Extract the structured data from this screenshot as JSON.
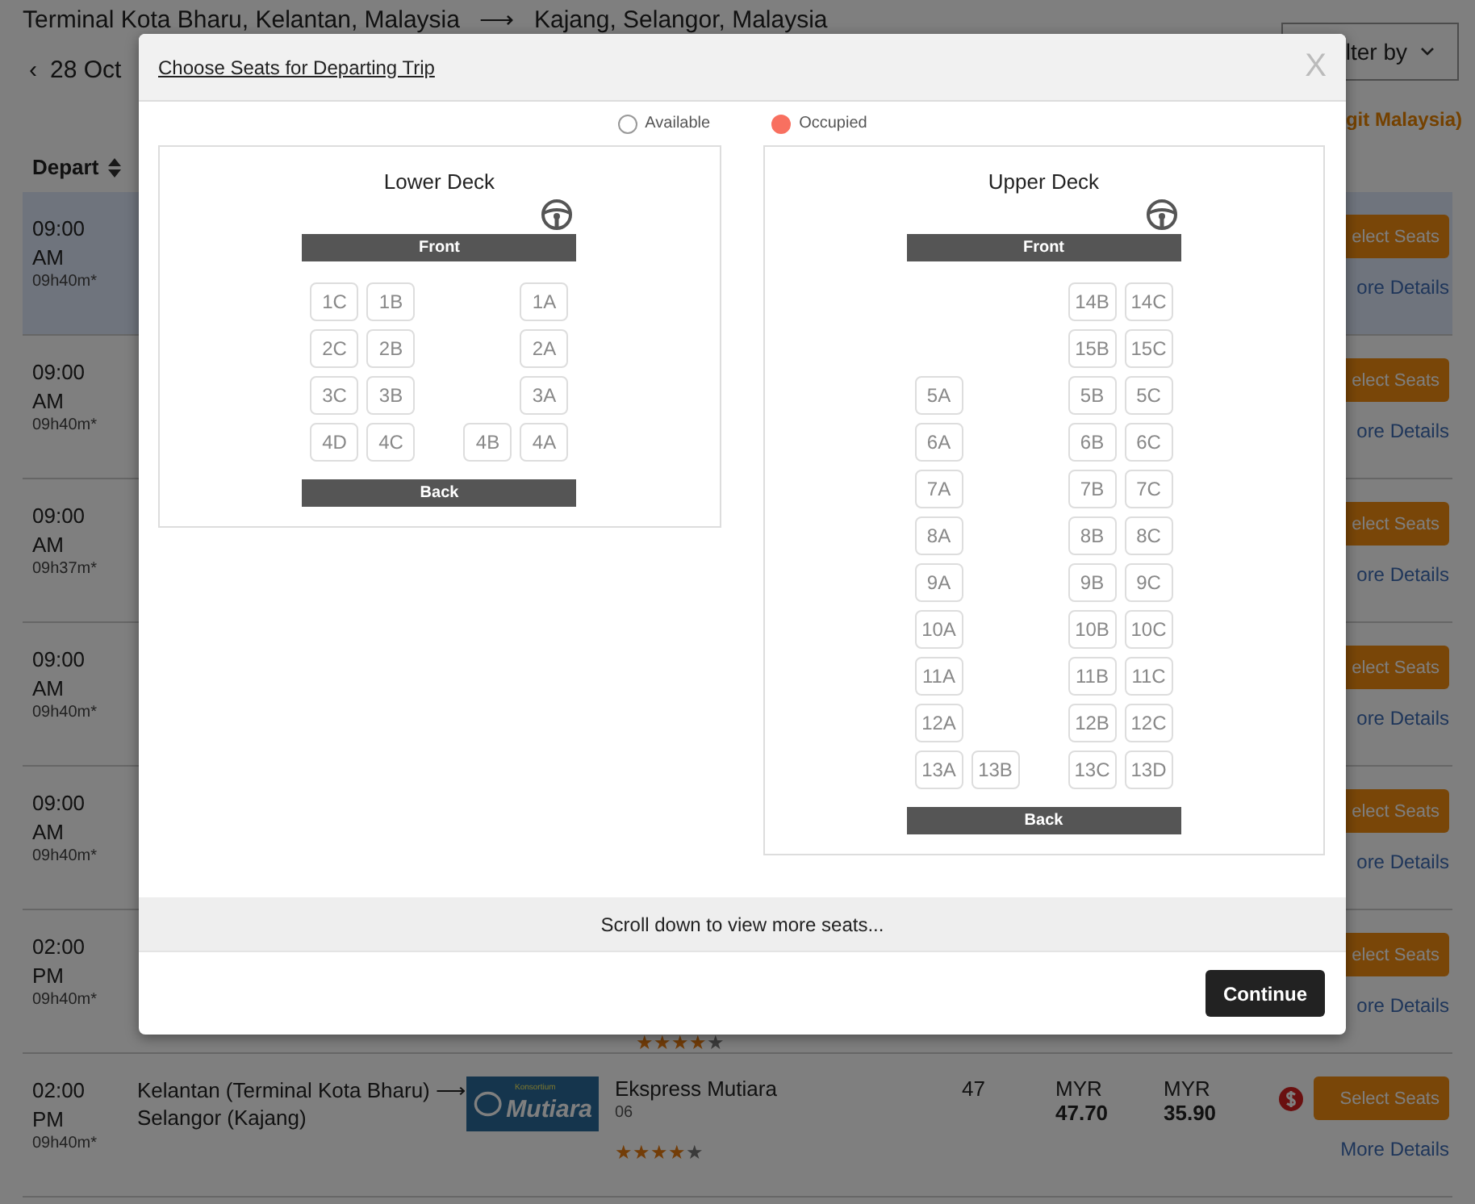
{
  "route": {
    "origin": "Terminal Kota Bharu, Kelantan, Malaysia",
    "arrow": "⟶",
    "destination": "Kajang, Selangor, Malaysia"
  },
  "date": {
    "back": "‹",
    "label": "28 Oct"
  },
  "filter_button": {
    "label": "lter by"
  },
  "currency_note": "git Malaysia)",
  "column_header": {
    "label": "Depart"
  },
  "trips": [
    {
      "time": "09:00",
      "period": "AM",
      "duration": "09h40m*",
      "selected": true,
      "select_label": "elect Seats",
      "details_label": "ore Details"
    },
    {
      "time": "09:00",
      "period": "AM",
      "duration": "09h40m*",
      "selected": false,
      "select_label": "elect Seats",
      "details_label": "ore Details"
    },
    {
      "time": "09:00",
      "period": "AM",
      "duration": "09h37m*",
      "selected": false,
      "select_label": "elect Seats",
      "details_label": "ore Details"
    },
    {
      "time": "09:00",
      "period": "AM",
      "duration": "09h40m*",
      "selected": false,
      "select_label": "elect Seats",
      "details_label": "ore Details"
    },
    {
      "time": "09:00",
      "period": "AM",
      "duration": "09h40m*",
      "selected": false,
      "select_label": "elect Seats",
      "details_label": "ore Details"
    },
    {
      "time": "02:00",
      "period": "PM",
      "duration": "09h40m*",
      "selected": false,
      "select_label": "elect Seats",
      "details_label": "ore Details",
      "stars": 4
    },
    {
      "time": "02:00",
      "period": "PM",
      "duration": "09h40m*",
      "selected": false,
      "route": "Kelantan (Terminal Kota Bharu) ⟶ Selangor (Kajang)",
      "logo_small": "Konsortium",
      "logo_text": "Mutiara",
      "operator": "Ekspress Mutiara",
      "code": "06",
      "stars": 4,
      "seats": "47",
      "price_1_currency": "MYR",
      "price_1": "47.70",
      "price_2_currency": "MYR",
      "price_2": "35.90",
      "select_label": "Select Seats",
      "details_label": "More Details"
    }
  ],
  "modal": {
    "title": "Choose Seats for Departing Trip",
    "close": "X",
    "legend": [
      {
        "label": "Available",
        "kind": "available"
      },
      {
        "label": "Occupied",
        "kind": "occupied"
      }
    ],
    "decks": [
      {
        "title": "Lower Deck",
        "front": "Front",
        "back": "Back",
        "rows": [
          [
            {
              "label": "1C",
              "occupied": false
            },
            {
              "label": "1B",
              "occupied": false
            },
            null,
            null,
            {
              "label": "1A",
              "occupied": false
            }
          ],
          [
            {
              "label": "2C",
              "occupied": false
            },
            {
              "label": "2B",
              "occupied": false
            },
            null,
            null,
            {
              "label": "2A",
              "occupied": false
            }
          ],
          [
            {
              "label": "3C",
              "occupied": false
            },
            {
              "label": "3B",
              "occupied": false
            },
            null,
            null,
            {
              "label": "3A",
              "occupied": false
            }
          ],
          [
            {
              "label": "4D",
              "occupied": false
            },
            {
              "label": "4C",
              "occupied": false
            },
            null,
            {
              "label": "4B",
              "occupied": false
            },
            {
              "label": "4A",
              "occupied": false
            }
          ]
        ]
      },
      {
        "title": "Upper Deck",
        "front": "Front",
        "back": "Back",
        "rows": [
          [
            null,
            null,
            null,
            {
              "label": "14B",
              "occupied": false
            },
            {
              "label": "14C",
              "occupied": false
            }
          ],
          [
            null,
            null,
            null,
            {
              "label": "15B",
              "occupied": false
            },
            {
              "label": "15C",
              "occupied": false
            }
          ],
          [
            {
              "label": "5A",
              "occupied": false
            },
            null,
            null,
            {
              "label": "5B",
              "occupied": false
            },
            {
              "label": "5C",
              "occupied": false
            }
          ],
          [
            {
              "label": "6A",
              "occupied": false
            },
            null,
            null,
            {
              "label": "6B",
              "occupied": false
            },
            {
              "label": "6C",
              "occupied": false
            }
          ],
          [
            {
              "label": "7A",
              "occupied": false
            },
            null,
            null,
            {
              "label": "7B",
              "occupied": false
            },
            {
              "label": "7C",
              "occupied": false
            }
          ],
          [
            {
              "label": "8A",
              "occupied": false
            },
            null,
            null,
            {
              "label": "8B",
              "occupied": false
            },
            {
              "label": "8C",
              "occupied": false
            }
          ],
          [
            {
              "label": "9A",
              "occupied": false
            },
            null,
            null,
            {
              "label": "9B",
              "occupied": false
            },
            {
              "label": "9C",
              "occupied": false
            }
          ],
          [
            {
              "label": "10A",
              "occupied": false
            },
            null,
            null,
            {
              "label": "10B",
              "occupied": false
            },
            {
              "label": "10C",
              "occupied": false
            }
          ],
          [
            {
              "label": "11A",
              "occupied": false
            },
            null,
            null,
            {
              "label": "11B",
              "occupied": false
            },
            {
              "label": "11C",
              "occupied": false
            }
          ],
          [
            {
              "label": "12A",
              "occupied": false
            },
            null,
            null,
            {
              "label": "12B",
              "occupied": false
            },
            {
              "label": "12C",
              "occupied": false
            }
          ],
          [
            {
              "label": "13A",
              "occupied": false
            },
            {
              "label": "13B",
              "occupied": false
            },
            null,
            {
              "label": "13C",
              "occupied": false
            },
            {
              "label": "13D",
              "occupied": false
            }
          ]
        ]
      }
    ],
    "scroll_hint": "Scroll down to view more seats...",
    "continue_button": "Continue"
  }
}
